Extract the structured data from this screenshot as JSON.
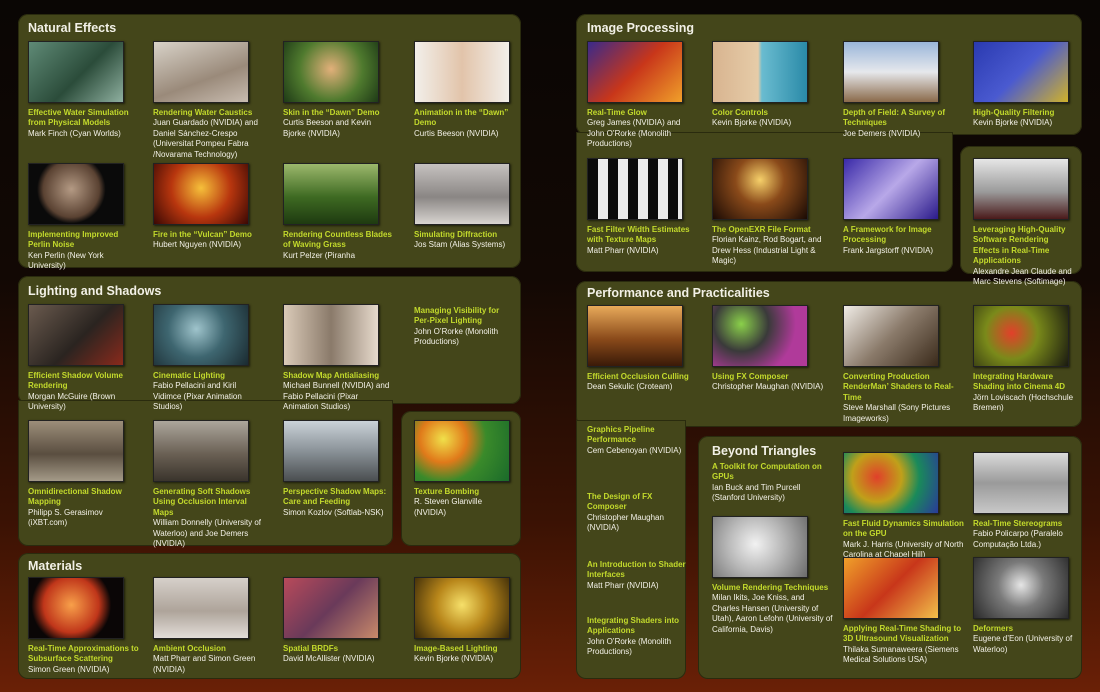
{
  "sections": {
    "natural": {
      "title": "Natural Effects"
    },
    "lighting": {
      "title": "Lighting and Shadows"
    },
    "materials": {
      "title": "Materials"
    },
    "image": {
      "title": "Image Processing"
    },
    "performance": {
      "title": "Performance and Practicalities"
    },
    "beyond": {
      "title": "Beyond Triangles"
    }
  },
  "items": [
    {
      "section": "natural",
      "name": "water-simulation",
      "title": "Effective Water Simulation from Physical Models",
      "authors": "Mark Finch (Cyan Worlds)",
      "thumb": "linear-gradient(135deg,#5f8a76,#2b4c3a 55%,#8fb0a0)"
    },
    {
      "section": "natural",
      "name": "water-caustics",
      "title": "Rendering Water Caustics",
      "authors": "Juan Guardado (NVIDIA) and Daniel Sánchez-Crespo (Universitat Pompeu Fabra /Novarama Technology)",
      "thumb": "linear-gradient(160deg,#d8d2c8,#9a8a7a 60%,#c8bcb0)"
    },
    {
      "section": "natural",
      "name": "dawn-skin",
      "title": "Skin in the “Dawn” Demo",
      "authors": "Curtis Beeson and Kevin Bjorke (NVIDIA)",
      "thumb": "radial-gradient(circle at 50% 45%,#e2b07a,#4f7a2e 55%,#1e3a16)"
    },
    {
      "section": "natural",
      "name": "dawn-animation",
      "title": "Animation in the “Dawn” Demo",
      "authors": "Curtis Beeson (NVIDIA)",
      "thumb": "linear-gradient(90deg,#f2efea,#e2c4aa 50%,#f2efea)"
    },
    {
      "section": "natural",
      "name": "perlin-noise",
      "title": "Implementing Improved Perlin Noise",
      "authors": "Ken Perlin (New York University)",
      "thumb": "radial-gradient(circle at 45% 42%,#b49a84,#5a4232 45%,#0a0a0a 55%)"
    },
    {
      "section": "natural",
      "name": "vulcan-fire",
      "title": "Fire in the “Vulcan” Demo",
      "authors": "Hubert Nguyen (NVIDIA)",
      "thumb": "radial-gradient(circle at 50% 40%,#f6c03a,#b8360e 50%,#3a0804)"
    },
    {
      "section": "natural",
      "name": "grass-blades",
      "title": "Rendering Countless Blades of Waving Grass",
      "authors": "Kurt Pelzer (Piranha",
      "thumb": "linear-gradient(180deg,#9cb86c,#3e6a22 55%,#1e3a10)"
    },
    {
      "section": "natural",
      "name": "diffraction",
      "title": "Simulating Diffraction",
      "authors": "Jos Stam (Alias Systems)",
      "thumb": "linear-gradient(180deg,#c6c2c0,#8a8684 55%,#d8d4d0)"
    },
    {
      "section": "lighting",
      "name": "shadow-volume",
      "title": "Efficient Shadow Volume Rendering",
      "authors": "Morgan McGuire (Brown University)",
      "thumb": "linear-gradient(135deg,#6a5a4e,#2a2420 55%,#8a2a1c)"
    },
    {
      "section": "lighting",
      "name": "cinematic-lighting",
      "title": "Cinematic Lighting",
      "authors": "Fabio Pellacini and Kiril Vidimce (Pixar Animation Studios)",
      "thumb": "radial-gradient(circle at 45% 40%,#9fc4cc,#3e6670 45%,#1a2a30)"
    },
    {
      "section": "lighting",
      "name": "shadow-map-aa",
      "title": "Shadow Map Antialiasing",
      "authors": "Michael Bunnell (NVIDIA) and Fabio Pellacini (Pixar Animation Studios)",
      "thumb": "linear-gradient(90deg,#dacab8,#8a7a6a 50%,#e6dacc)"
    },
    {
      "section": "lighting",
      "name": "visibility-lighting",
      "title": "Managing Visibility for Per-Pixel Lighting",
      "authors": "John O’Rorke (Monolith Productions)",
      "thumb": ""
    },
    {
      "section": "lighting",
      "name": "omni-shadow",
      "title": "Omnidirectional Shadow Mapping",
      "authors": "Philipp S. Gerasimov (iXBT.com)",
      "thumb": "linear-gradient(180deg,#9c8e7a,#5a4e40 55%,#a49a88)"
    },
    {
      "section": "lighting",
      "name": "soft-shadows",
      "title": "Generating Soft Shadows Using Occlusion Interval Maps",
      "authors": "William Donnelly (University of Waterloo) and Joe Demers (NVIDIA)",
      "thumb": "linear-gradient(180deg,#aca69c,#6a6054 55%,#3a342c)"
    },
    {
      "section": "lighting",
      "name": "perspective-shadow",
      "title": "Perspective Shadow Maps: Care and Feeding",
      "authors": "Simon Kozlov (Softlab-NSK)",
      "thumb": "linear-gradient(180deg,#cad2d8,#8a9298 50%,#4a4e50)"
    },
    {
      "section": "lighting",
      "name": "texture-bombing",
      "title": "Texture Bombing",
      "authors": "R. Steven Glanville (NVIDIA)",
      "thumb": "radial-gradient(circle at 30% 30%,#f0e04a,#e07a1a 30%,#3a8a2a 55%,#1a6a2a)"
    },
    {
      "section": "materials",
      "name": "subsurface",
      "title": "Real-Time Approximations to Subsurface Scattering",
      "authors": "Simon Green (NVIDIA)",
      "thumb": "radial-gradient(circle at 45% 45%,#f8a04a,#c0361a 45%,#0a0606 65%)"
    },
    {
      "section": "materials",
      "name": "ambient-occlusion",
      "title": "Ambient Occlusion",
      "authors": "Matt Pharr and Simon Green (NVIDIA)",
      "thumb": "linear-gradient(180deg,#d6d0ca,#aea49a 55%,#e2ddd8)"
    },
    {
      "section": "materials",
      "name": "spatial-brdf",
      "title": "Spatial BRDFs",
      "authors": "David McAllister (NVIDIA)",
      "thumb": "linear-gradient(135deg,#b84a5a,#6a3a5a 50%,#c88a6a)"
    },
    {
      "section": "materials",
      "name": "image-lighting",
      "title": "Image-Based Lighting",
      "authors": "Kevin Bjorke (NVIDIA)",
      "thumb": "radial-gradient(circle at 50% 45%,#f6e06a,#b8861a 45%,#3a2a08)"
    },
    {
      "section": "image",
      "name": "real-time-glow",
      "title": "Real-Time Glow",
      "authors": "Greg James (NVIDIA) and John O’Rorke (Monolith Productions)",
      "thumb": "linear-gradient(135deg,#3a2a8a,#c8361a 50%,#f0a02a)"
    },
    {
      "section": "image",
      "name": "color-controls",
      "title": "Color Controls",
      "authors": "Kevin Bjorke (NVIDIA)",
      "thumb": "linear-gradient(90deg,#d8b490,#e6cca8 48%,#6abcd0 52%,#2a8aa8)"
    },
    {
      "section": "image",
      "name": "depth-of-field",
      "title": "Depth of Field: A Survey of Techniques",
      "authors": "Joe Demers (NVIDIA)",
      "thumb": "linear-gradient(180deg,#9ab6da,#e6e8ec 50%,#8a6a4a)"
    },
    {
      "section": "image",
      "name": "filtering",
      "title": "High-Quality Filtering",
      "authors": "Kevin Bjorke (NVIDIA)",
      "thumb": "linear-gradient(135deg,#2a3ab0,#4a5ad0 50%,#d0b22a)"
    },
    {
      "section": "image",
      "name": "filter-width",
      "title": "Fast Filter Width Estimates with Texture Maps",
      "authors": "Matt Pharr (NVIDIA)",
      "thumb": "repeating-linear-gradient(90deg,#0a0a0a 0 10px,#eaeaea 10px 20px)"
    },
    {
      "section": "image",
      "name": "openexr",
      "title": "The OpenEXR File Format",
      "authors": "Florian Kainz, Rod Bogart, and Drew Hess (Industrial Light & Magic)",
      "thumb": "radial-gradient(circle at 50% 35%,#f6d06a,#8a4a1a 40%,#1a0a04)"
    },
    {
      "section": "image",
      "name": "image-framework",
      "title": "A Framework for Image Processing",
      "authors": "Frank Jargstorff (NVIDIA)",
      "thumb": "linear-gradient(135deg,#3a2aa8,#b8a8e8 50%,#2a1a8a)"
    },
    {
      "section": "image",
      "name": "hardware-software",
      "title": "Leveraging High-Quality Software Rendering Effects in Real-Time Applications",
      "authors": "Alexandre Jean Claude and Marc Stevens (Softimage)",
      "thumb": "linear-gradient(180deg,#e6e6e6,#9a9a9a 55%,#4a1a1a)"
    },
    {
      "section": "performance",
      "name": "occlusion-culling",
      "title": "Efficient Occlusion Culling",
      "authors": "Dean Sekulic (Croteam)",
      "thumb": "linear-gradient(180deg,#e8aa5a,#8a4a1a 55%,#3a1a08)"
    },
    {
      "section": "performance",
      "name": "fx-composer",
      "title": "Using FX Composer",
      "authors": "Christopher Maughan (NVIDIA)",
      "thumb": "radial-gradient(circle at 30% 30%,#8ad04a,#3a3a3a 35%,#b03a9a 70%)"
    },
    {
      "section": "performance",
      "name": "renderman",
      "title": "Converting Production RenderMan’ Shaders to Real-Time",
      "authors": "Steve Marshall (Sony Pictures Imageworks)",
      "thumb": "linear-gradient(135deg,#f0ece6,#8a7a6a 50%,#3a2a1a)"
    },
    {
      "section": "performance",
      "name": "cinema4d",
      "title": "Integrating Hardware Shading into Cinema 4D",
      "authors": "Jörn Loviscach (Hochschule Bremen)",
      "thumb": "radial-gradient(circle at 40% 45%,#e2402a,#7a8a1a 40%,#1a1a10)"
    },
    {
      "section": "performance",
      "name": "pipeline",
      "title": "Graphics Pipeline Performance",
      "authors": "Cem Cebenoyan (NVIDIA)",
      "thumb": ""
    },
    {
      "section": "performance",
      "name": "fx-design",
      "title": "The Design of FX Composer",
      "authors": "Christopher Maughan (NVIDIA)",
      "thumb": ""
    },
    {
      "section": "performance",
      "name": "shader-interfaces",
      "title": "An Introduction to Shader Interfaces",
      "authors": "Matt Pharr (NVIDIA)",
      "thumb": ""
    },
    {
      "section": "performance",
      "name": "shaders-apps",
      "title": "Integrating Shaders into Applications",
      "authors": "John O’Rorke (Monolith Productions)",
      "thumb": ""
    },
    {
      "section": "beyond",
      "name": "gpu-toolkit",
      "title": "A Toolkit for Computation on GPUs",
      "authors": "Ian Buck and Tim Purcell (Stanford University)",
      "thumb": ""
    },
    {
      "section": "beyond",
      "name": "fluid-dynamics",
      "title": "Fast Fluid Dynamics Simulation on the GPU",
      "authors": "Mark  J. Harris (University of North Carolina at Chapel Hill)",
      "thumb": "radial-gradient(circle at 35% 40%,#e0402a,#c0a01a 35%,#1a8a5a 60%,#2a3a9a)"
    },
    {
      "section": "beyond",
      "name": "stereograms",
      "title": "Real-Time Stereograms",
      "authors": "Fabio Policarpo (Paralelo Computação Ltda.)",
      "thumb": "linear-gradient(180deg,#dadada,#9a9a9a 50%,#c8c8c8)"
    },
    {
      "section": "beyond",
      "name": "volume-rendering",
      "title": "Volume Rendering Techniques",
      "authors": "Milan Ikits,  Joe Kniss, and Charles Hansen (University of Utah), Aaron Lefohn (University of California, Davis)",
      "thumb": "radial-gradient(circle at 45% 45%,#f2f2f2,#b8b8b8 45%,#6a6a6a)"
    },
    {
      "section": "beyond",
      "name": "ultrasound",
      "title": "Applying Real-Time Shading to 3D Ultrasound Visualization",
      "authors": "Thilaka Sumanaweera (Siemens Medical Solutions USA)",
      "thumb": "linear-gradient(135deg,#f0a02a,#c8361a 50%,#f2c04a)"
    },
    {
      "section": "beyond",
      "name": "deformers",
      "title": "Deformers",
      "authors": "Eugene d’Eon (University of Waterloo)",
      "thumb": "radial-gradient(circle at 50% 45%,#e6e6e6,#7a7a7a 40%,#2a2a2a)"
    }
  ]
}
